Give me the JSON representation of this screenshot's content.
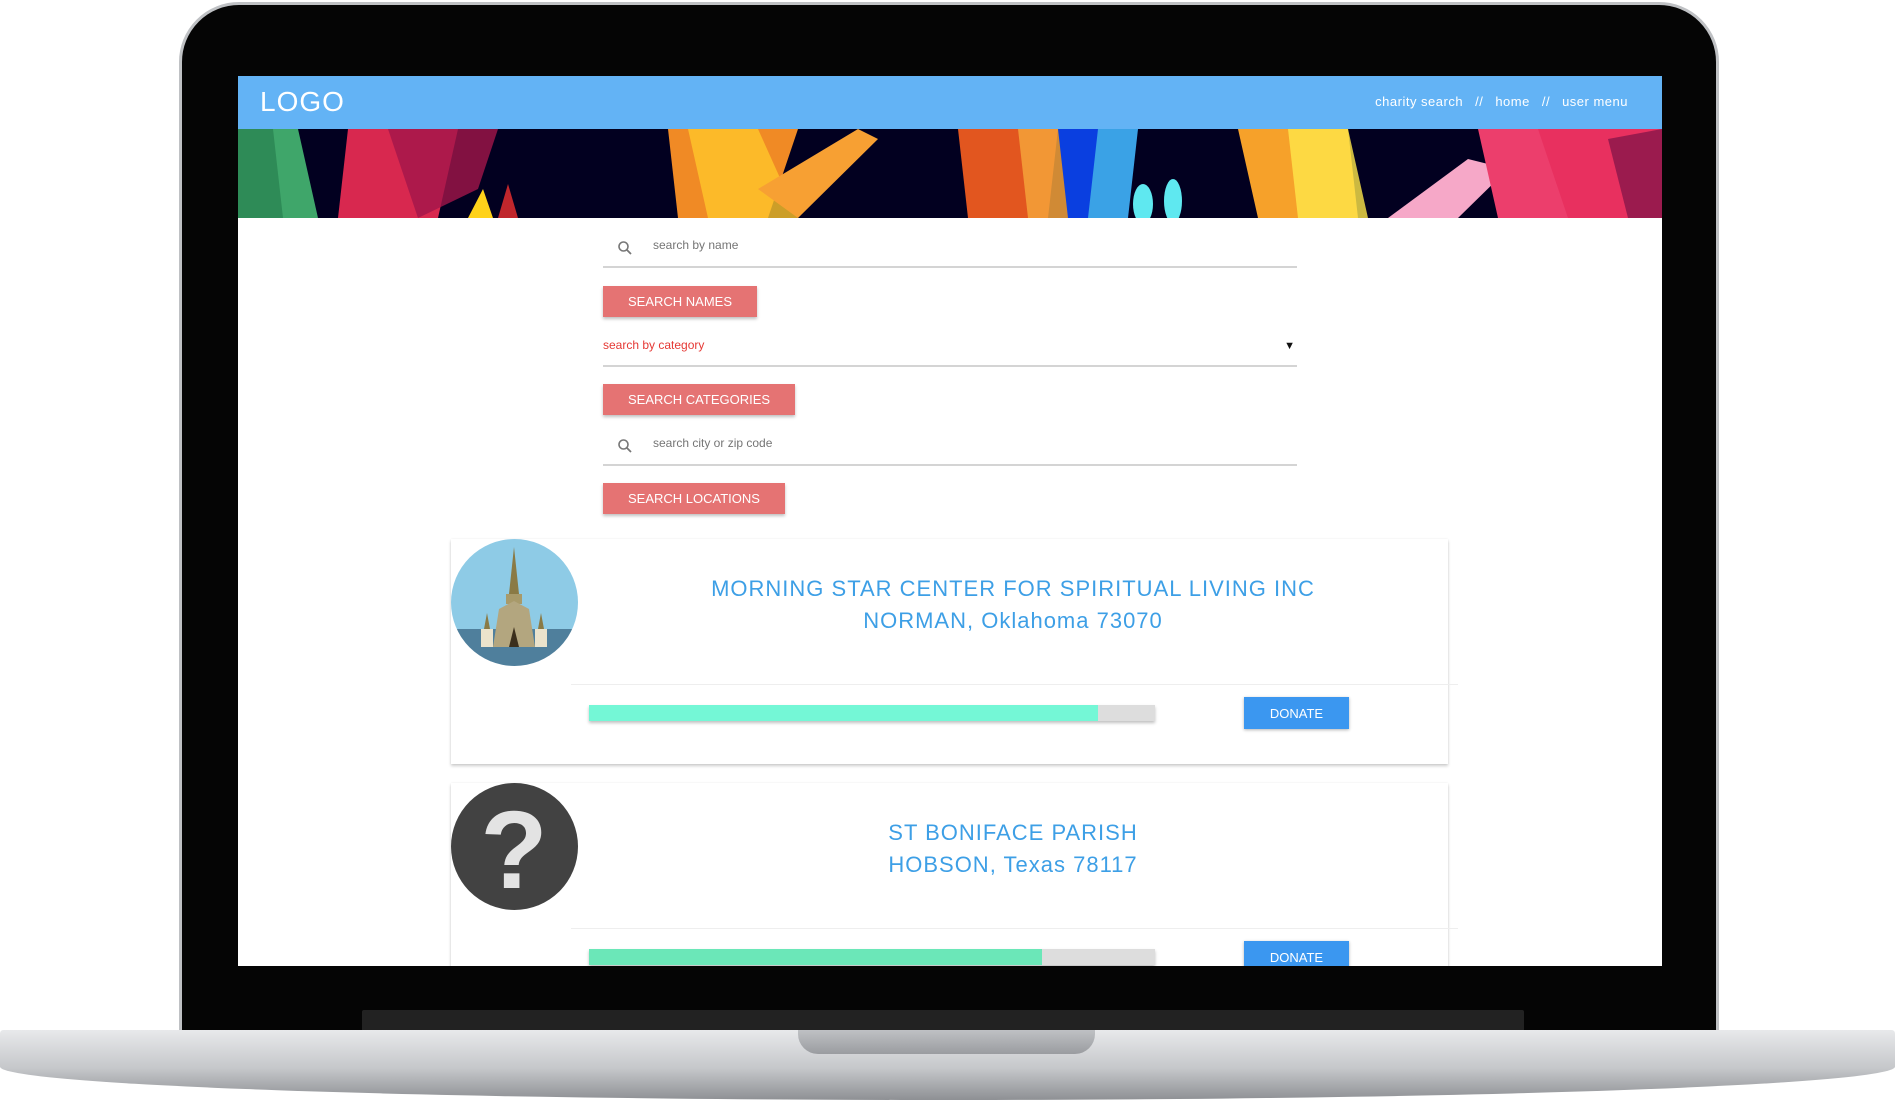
{
  "header": {
    "logo": "LOGO",
    "nav": [
      "charity search",
      "//",
      "home",
      "//",
      "user menu"
    ]
  },
  "search": {
    "name_placeholder": "search by name",
    "name_button": "SEARCH NAMES",
    "category_selected": "search by category",
    "category_button": "SEARCH CATEGORIES",
    "location_placeholder": "search city or zip code",
    "location_button": "SEARCH LOCATIONS"
  },
  "results": [
    {
      "name": "MORNING STAR CENTER FOR SPIRITUAL LIVING INC",
      "location": "NORMAN, Oklahoma 73070",
      "progress": 0.9,
      "progress_color": "#74f7d6",
      "donate": "DONATE",
      "avatar": "church-image"
    },
    {
      "name": "ST BONIFACE PARISH",
      "location": "HOBSON, Texas 78117",
      "progress": 0.8,
      "progress_color": "#6be7b8",
      "donate": "DONATE",
      "avatar": "question-mark-icon"
    }
  ]
}
